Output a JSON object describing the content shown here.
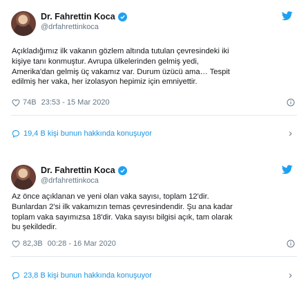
{
  "tweets": [
    {
      "author_name": "Dr. Fahrettin Koca",
      "handle": "@drfahrettinkoca",
      "text_lines": [
        "Açıkladığımız ilk vakanın gözlem altında tutulan çevresindeki iki",
        "kişiye tanı konmuştur. Avrupa ülkelerinden gelmiş yedi,",
        "Amerika'dan gelmiş üç vakamız var. Durum üzücü ama… Tespit",
        "edilmiş her vaka, her izolasyon hepimiz için emniyettir."
      ],
      "likes": "74B",
      "timestamp": "23:53 - 15 Mar 2020",
      "conversation": "19,4 B kişi bunun hakkında konuşuyor"
    },
    {
      "author_name": "Dr. Fahrettin Koca",
      "handle": "@drfahrettinkoca",
      "text_lines": [
        "Az önce açıklanan ve yeni olan vaka sayısı, toplam 12'dir.",
        "Bunlardan 2'si ilk vakamızın temas çevresindendir. Şu ana kadar",
        "toplam vaka sayımızsa 18'dir. Vaka sayısı bilgisi açık, tam olarak",
        "bu şekildedir."
      ],
      "likes": "82,3B",
      "timestamp": "00:28 - 16 Mar 2020",
      "conversation": "23,8 B kişi bunun hakkında konuşuyor"
    }
  ],
  "icons": {
    "verified": "verified-badge-icon",
    "twitter": "twitter-bird-icon",
    "like": "heart-icon",
    "info": "info-icon",
    "conversation": "speech-bubble-icon",
    "chevron": "chevron-right-icon"
  },
  "colors": {
    "accent": "#1da1f2",
    "link": "#1b95e0",
    "secondary_text": "#657786",
    "divider": "#e1e8ed"
  }
}
